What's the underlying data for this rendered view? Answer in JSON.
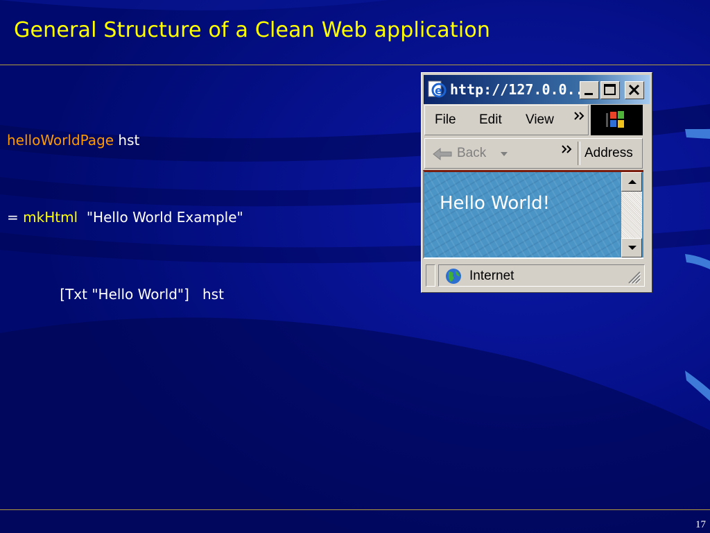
{
  "slide": {
    "title": "General Structure of a Clean Web application",
    "page_number": "17"
  },
  "code": {
    "line1": {
      "name": "helloWorldPage",
      "rest": " hst"
    },
    "line2": {
      "prefix": "= ",
      "func": "mkHtml",
      "rest": "  \"Hello World Example\""
    },
    "line3": {
      "text": "            [Txt \"Hello World\"]   hst"
    }
  },
  "browser": {
    "title": "http://127.0.0...",
    "menu": {
      "file": "File",
      "edit": "Edit",
      "view": "View"
    },
    "toolbar": {
      "back": "Back",
      "address": "Address"
    },
    "content": {
      "text": "Hello World!"
    },
    "status": {
      "zone": "Internet"
    }
  },
  "colors": {
    "background": "#000a6e",
    "title": "#ffff00",
    "identifier": "#ff9900",
    "keyword": "#ffff00",
    "rule": "#b49b3c"
  }
}
